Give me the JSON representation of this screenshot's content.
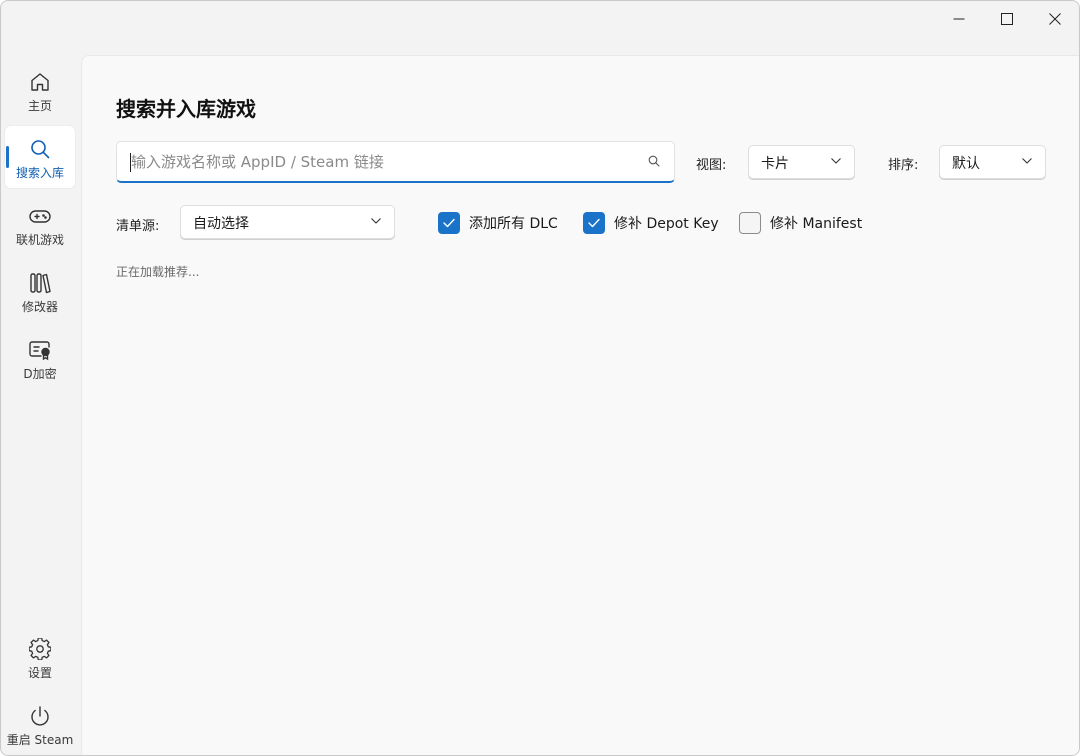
{
  "window": {
    "controls": {
      "minimize": "minimize-icon",
      "maximize": "maximize-icon",
      "close": "close-icon"
    }
  },
  "sidebar": {
    "items": [
      {
        "label": "主页",
        "icon": "home-icon",
        "active": false
      },
      {
        "label": "搜索入库",
        "icon": "search-icon",
        "active": true
      },
      {
        "label": "联机游戏",
        "icon": "gamepad-icon",
        "active": false
      },
      {
        "label": "修改器",
        "icon": "library-icon",
        "active": false
      },
      {
        "label": "D加密",
        "icon": "certificate-icon",
        "active": false
      }
    ],
    "bottom_items": [
      {
        "label": "设置",
        "icon": "gear-icon"
      },
      {
        "label": "重启 Steam",
        "icon": "power-icon"
      }
    ]
  },
  "main": {
    "title": "搜索并入库游戏",
    "search": {
      "placeholder": "输入游戏名称或 AppID / Steam 链接",
      "value": ""
    },
    "view": {
      "label": "视图:",
      "value": "卡片"
    },
    "sort": {
      "label": "排序:",
      "value": "默认"
    },
    "source": {
      "label": "清单源:",
      "value": "自动选择"
    },
    "options": [
      {
        "label": "添加所有 DLC",
        "checked": true
      },
      {
        "label": "修补 Depot Key",
        "checked": true
      },
      {
        "label": "修补 Manifest",
        "checked": false
      }
    ],
    "status": "正在加载推荐..."
  },
  "colors": {
    "accent": "#1a73c8",
    "background": "#f3f3f3",
    "panel": "#f9f9f9"
  }
}
